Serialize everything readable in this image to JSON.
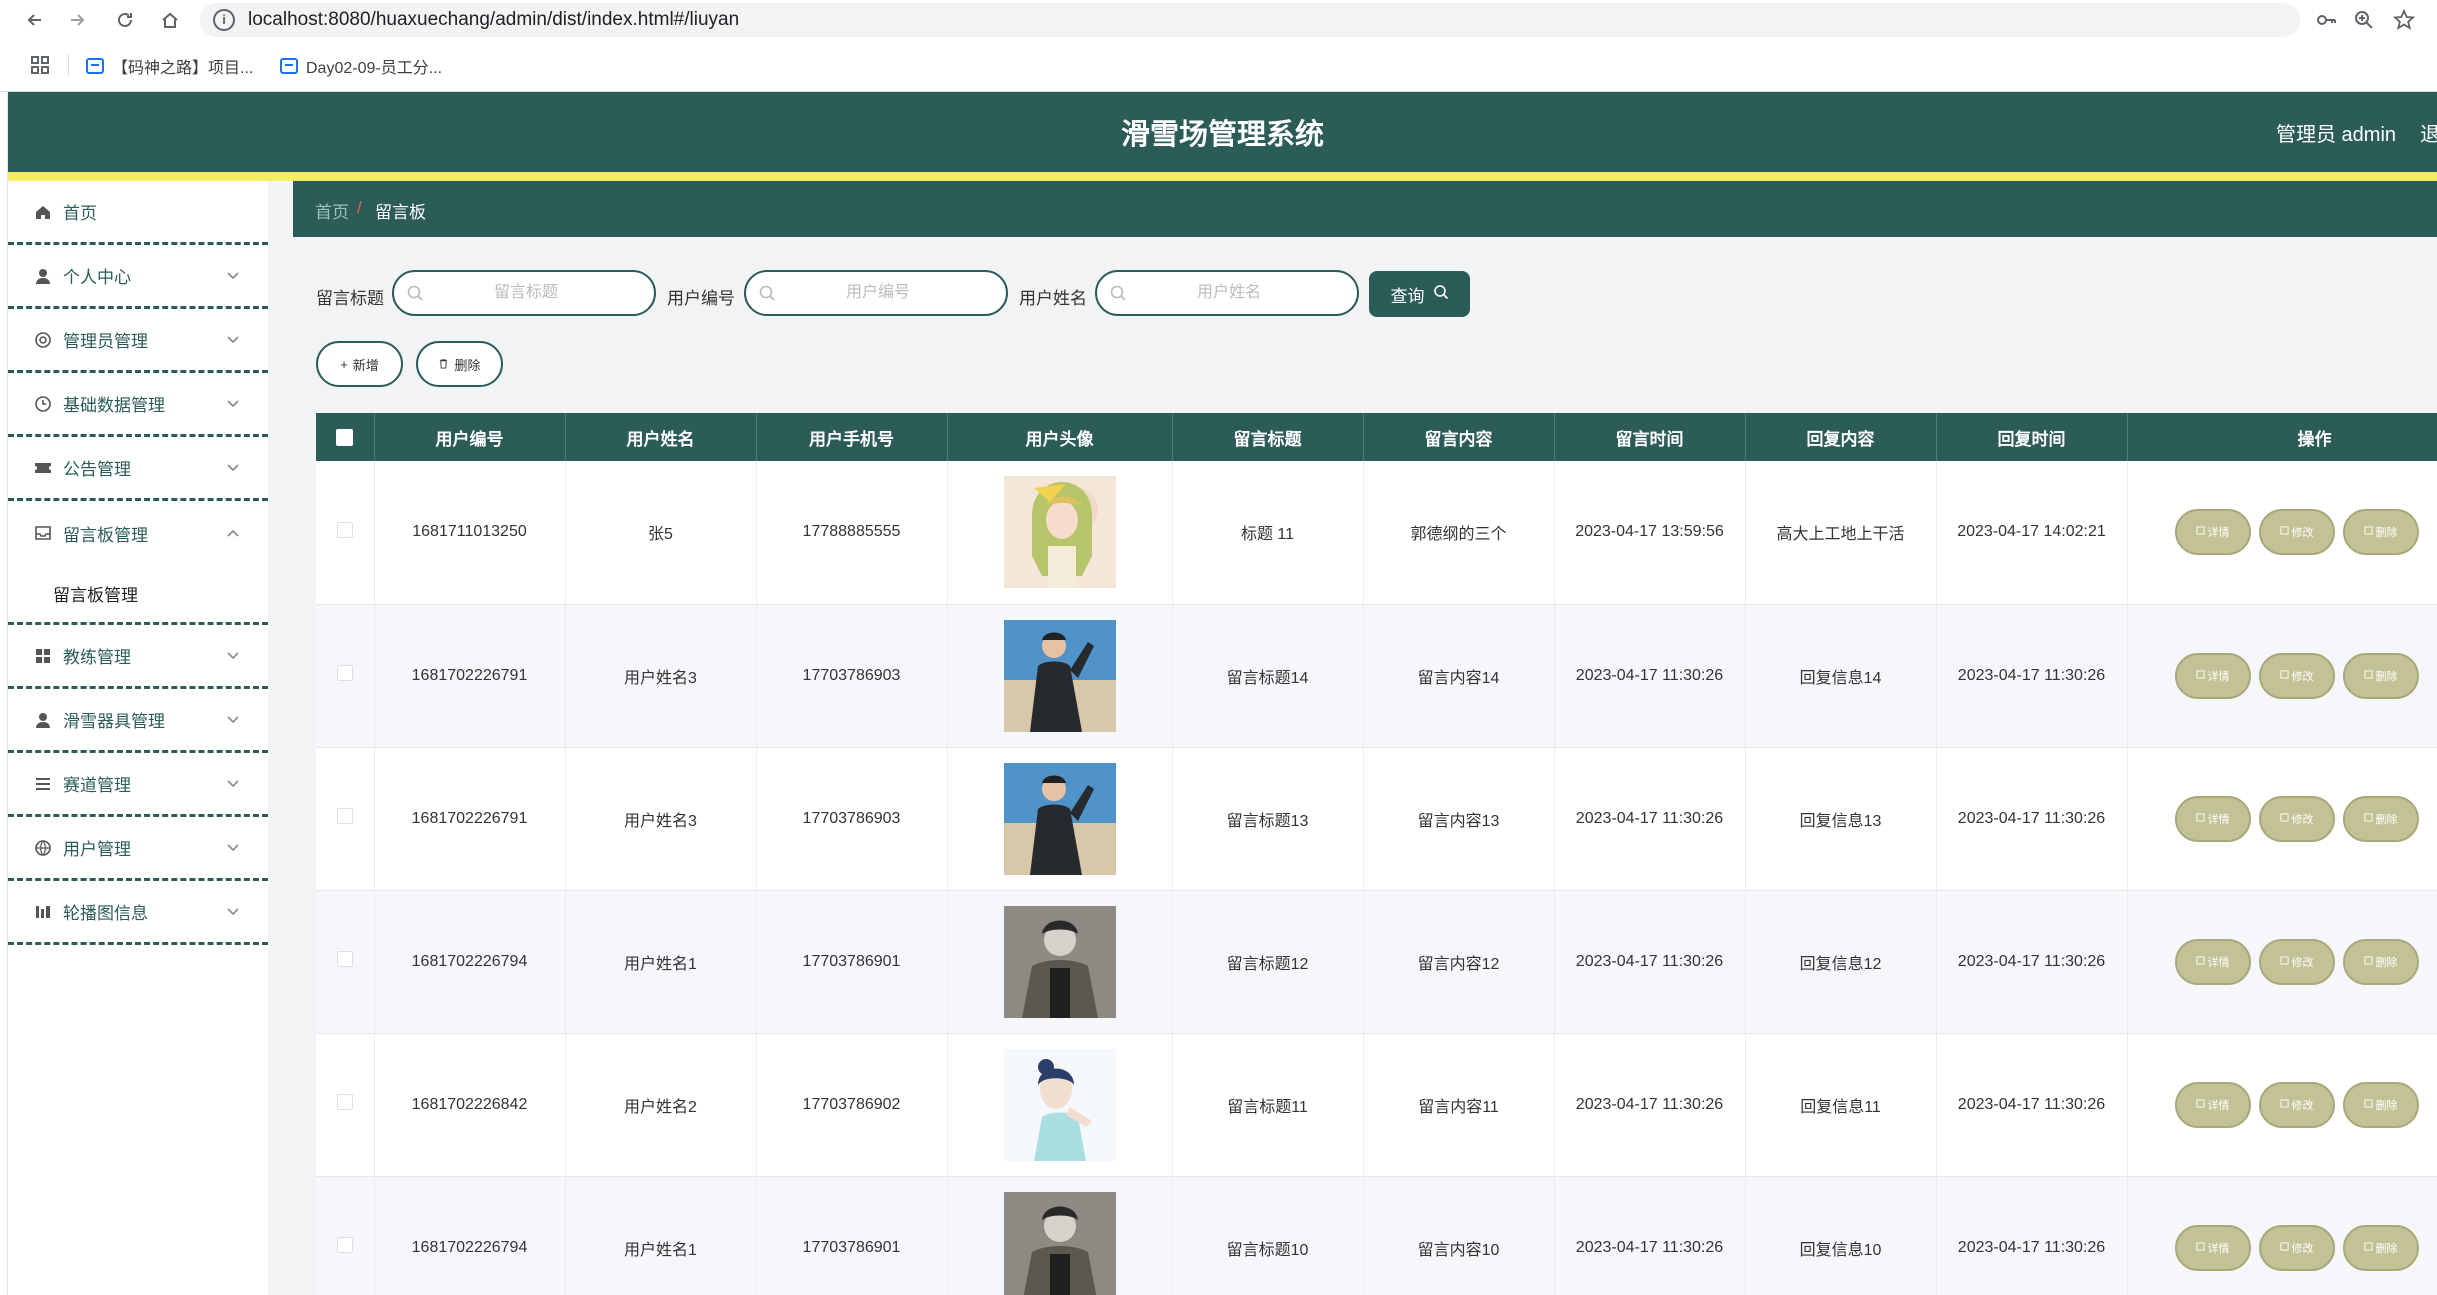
{
  "browser": {
    "url": "localhost:8080/huaxuechang/admin/dist/index.html#/liuyan",
    "bookmarks": [
      "【码神之路】项目...",
      "Day02-09-员工分..."
    ]
  },
  "header": {
    "title": "滑雪场管理系统",
    "admin_label": "管理员 admin",
    "logout_label": "退"
  },
  "sidebar": {
    "items": [
      {
        "label": "首页",
        "icon": "home-icon"
      },
      {
        "label": "个人中心",
        "icon": "user-icon"
      },
      {
        "label": "管理员管理",
        "icon": "admin-icon"
      },
      {
        "label": "基础数据管理",
        "icon": "clock-icon"
      },
      {
        "label": "公告管理",
        "icon": "ticket-icon"
      },
      {
        "label": "留言板管理",
        "icon": "inbox-icon"
      },
      {
        "label": "教练管理",
        "icon": "grid-icon"
      },
      {
        "label": "滑雪器具管理",
        "icon": "person-icon"
      },
      {
        "label": "赛道管理",
        "icon": "list-icon"
      },
      {
        "label": "用户管理",
        "icon": "globe-icon"
      },
      {
        "label": "轮播图信息",
        "icon": "chart-icon"
      }
    ],
    "submenu_label": "留言板管理"
  },
  "breadcrumb": {
    "home": "首页",
    "separator": "/",
    "current": "留言板"
  },
  "filters": {
    "title_label": "留言标题",
    "title_placeholder": "留言标题",
    "user_no_label": "用户编号",
    "user_no_placeholder": "用户编号",
    "user_name_label": "用户姓名",
    "user_name_placeholder": "用户姓名",
    "search_label": "查询"
  },
  "toolbar": {
    "add_label": "新增",
    "delete_label": "删除"
  },
  "table": {
    "headers": [
      "用户编号",
      "用户姓名",
      "用户手机号",
      "用户头像",
      "留言标题",
      "留言内容",
      "留言时间",
      "回复内容",
      "回复时间",
      "操作"
    ],
    "rows": [
      {
        "user_no": "1681711013250",
        "user_name": "张5",
        "phone": "17788885555",
        "avatar": "anime-girl",
        "title": "标题 11",
        "content": "郭德纲的三个",
        "time": "2023-04-17 13:59:56",
        "reply": "高大上工地上干活",
        "reply_time": "2023-04-17 14:02:21"
      },
      {
        "user_no": "1681702226791",
        "user_name": "用户姓名3",
        "phone": "17703786903",
        "avatar": "man-beach",
        "title": "留言标题14",
        "content": "留言内容14",
        "time": "2023-04-17 11:30:26",
        "reply": "回复信息14",
        "reply_time": "2023-04-17 11:30:26"
      },
      {
        "user_no": "1681702226791",
        "user_name": "用户姓名3",
        "phone": "17703786903",
        "avatar": "man-beach",
        "title": "留言标题13",
        "content": "留言内容13",
        "time": "2023-04-17 11:30:26",
        "reply": "回复信息13",
        "reply_time": "2023-04-17 11:30:26"
      },
      {
        "user_no": "1681702226794",
        "user_name": "用户姓名1",
        "phone": "17703786901",
        "avatar": "man-bw",
        "title": "留言标题12",
        "content": "留言内容12",
        "time": "2023-04-17 11:30:26",
        "reply": "回复信息12",
        "reply_time": "2023-04-17 11:30:26"
      },
      {
        "user_no": "1681702226842",
        "user_name": "用户姓名2",
        "phone": "17703786902",
        "avatar": "woman-blue",
        "title": "留言标题11",
        "content": "留言内容11",
        "time": "2023-04-17 11:30:26",
        "reply": "回复信息11",
        "reply_time": "2023-04-17 11:30:26"
      },
      {
        "user_no": "1681702226794",
        "user_name": "用户姓名1",
        "phone": "17703786901",
        "avatar": "man-bw",
        "title": "留言标题10",
        "content": "留言内容10",
        "time": "2023-04-17 11:30:26",
        "reply": "回复信息10",
        "reply_time": "2023-04-17 11:30:26"
      }
    ],
    "actions": {
      "detail": "详情",
      "edit": "修改",
      "delete": "删除"
    }
  }
}
